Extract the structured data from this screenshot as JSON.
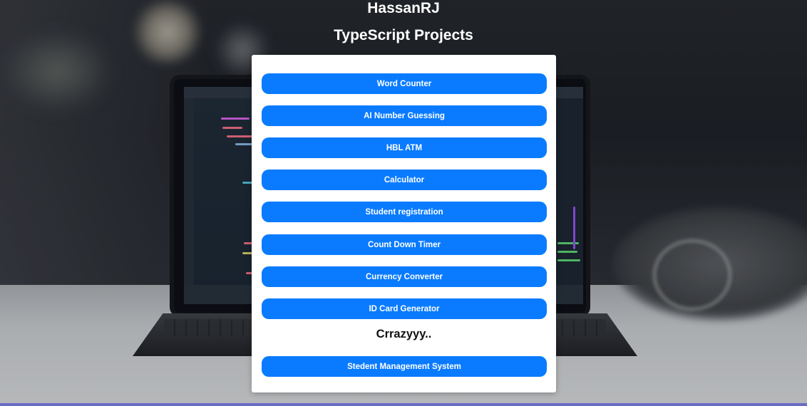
{
  "header": {
    "site_title": "HassanRJ",
    "page_title": "TypeScript Projects"
  },
  "projects": [
    {
      "label": "Word Counter"
    },
    {
      "label": "AI Number Guessing"
    },
    {
      "label": "HBL ATM"
    },
    {
      "label": "Calculator"
    },
    {
      "label": "Student registration"
    },
    {
      "label": "Count Down Timer"
    },
    {
      "label": "Currency Converter"
    },
    {
      "label": "ID Card Generator"
    }
  ],
  "section": {
    "label": "Crrazyyy.."
  },
  "extra_projects": [
    {
      "label": "Stedent Management System"
    }
  ],
  "colors": {
    "button": "#0a7bff",
    "button_text": "#ffffff",
    "card": "#ffffff",
    "heading": "#ffffff"
  }
}
